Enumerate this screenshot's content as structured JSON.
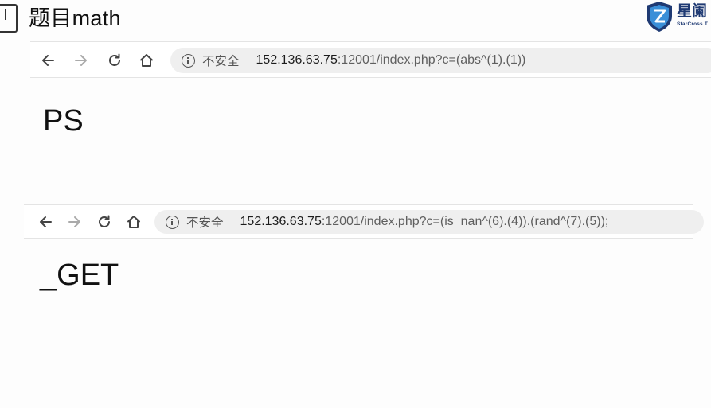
{
  "header": {
    "title": "题目math"
  },
  "logo": {
    "cn_text": "星阑",
    "en_text": "StarCross T",
    "brand_color": "#1f3a73",
    "accent_color": "#3a8fd8"
  },
  "browser_1": {
    "back_icon": "arrow-left-icon",
    "forward_icon": "arrow-right-icon",
    "reload_icon": "reload-icon",
    "home_icon": "home-icon",
    "security_label": "不安全",
    "url_host": "152.136.63.75",
    "url_rest": ":12001/index.php?c=(abs^(1).(1))",
    "page_output": "PS"
  },
  "browser_2": {
    "back_icon": "arrow-left-icon",
    "forward_icon": "arrow-right-icon",
    "reload_icon": "reload-icon",
    "home_icon": "home-icon",
    "security_label": "不安全",
    "url_host": "152.136.63.75",
    "url_rest": ":12001/index.php?c=(is_nan^(6).(4)).(rand^(7).(5));",
    "page_output": "_GET"
  }
}
